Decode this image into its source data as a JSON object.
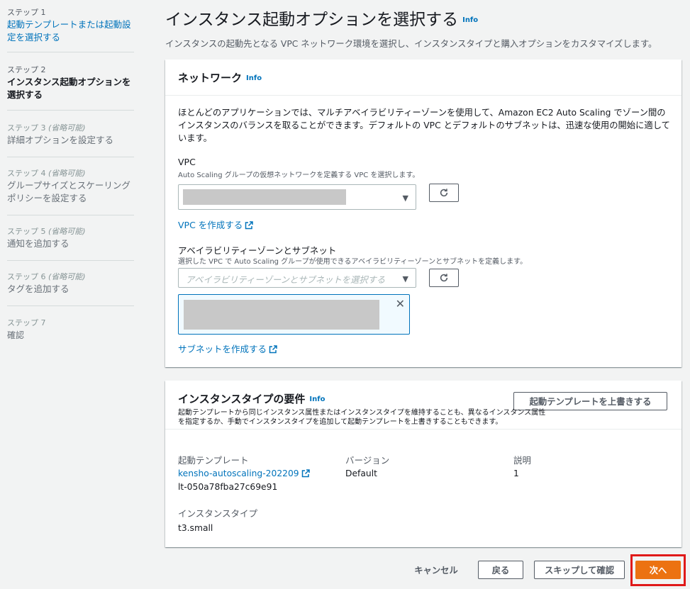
{
  "sidebar": {
    "steps": [
      {
        "label": "ステップ 1",
        "optional": "",
        "title": "起動テンプレートまたは起動設定を選択する",
        "state": "link"
      },
      {
        "label": "ステップ 2",
        "optional": "",
        "title": "インスタンス起動オプションを選択する",
        "state": "active"
      },
      {
        "label": "ステップ 3",
        "optional": "(省略可能)",
        "title": "詳細オプションを設定する",
        "state": "disabled"
      },
      {
        "label": "ステップ 4",
        "optional": "(省略可能)",
        "title": "グループサイズとスケーリングポリシーを設定する",
        "state": "disabled"
      },
      {
        "label": "ステップ 5",
        "optional": "(省略可能)",
        "title": "通知を追加する",
        "state": "disabled"
      },
      {
        "label": "ステップ 6",
        "optional": "(省略可能)",
        "title": "タグを追加する",
        "state": "disabled"
      },
      {
        "label": "ステップ 7",
        "optional": "",
        "title": "確認",
        "state": "disabled"
      }
    ]
  },
  "header": {
    "title": "インスタンス起動オプションを選択する",
    "info": "Info",
    "description": "インスタンスの起動先となる VPC ネットワーク環境を選択し、インスタンスタイプと購入オプションをカスタマイズします。"
  },
  "network": {
    "title": "ネットワーク",
    "info": "Info",
    "description": "ほとんどのアプリケーションでは、マルチアベイラビリティーゾーンを使用して、Amazon EC2 Auto Scaling でゾーン間のインスタンスのバランスを取ることができます。デフォルトの VPC とデフォルトのサブネットは、迅速な使用の開始に適しています。",
    "vpc_label": "VPC",
    "vpc_desc": "Auto Scaling グループの仮想ネットワークを定義する VPC を選択します。",
    "create_vpc": "VPC を作成する",
    "az_label": "アベイラビリティーゾーンとサブネット",
    "az_desc": "選択した VPC で Auto Scaling グループが使用できるアベイラビリティーゾーンとサブネットを定義します。",
    "az_placeholder": "アベイラビリティーゾーンとサブネットを選択する",
    "create_subnet": "サブネットを作成する"
  },
  "instance_type": {
    "title": "インスタンスタイプの要件",
    "info": "Info",
    "override_button": "起動テンプレートを上書きする",
    "description": "起動テンプレートから同じインスタンス属性またはインスタンスタイプを維持することも、異なるインスタンス属性を指定するか、手動でインスタンスタイプを追加して起動テンプレートを上書きすることもできます。",
    "launch_template_label": "起動テンプレート",
    "launch_template_name": "kensho-autoscaling-202209",
    "launch_template_id": "lt-050a78fba27c69e91",
    "version_label": "バージョン",
    "version_value": "Default",
    "desc_label": "説明",
    "desc_value": "1",
    "instance_type_label": "インスタンスタイプ",
    "instance_type_value": "t3.small"
  },
  "footer": {
    "cancel": "キャンセル",
    "back": "戻る",
    "skip": "スキップして確認",
    "next": "次へ"
  },
  "colors": {
    "accent": "#0073bb",
    "primary_button": "#ec7211",
    "highlight": "#e01a1a"
  }
}
